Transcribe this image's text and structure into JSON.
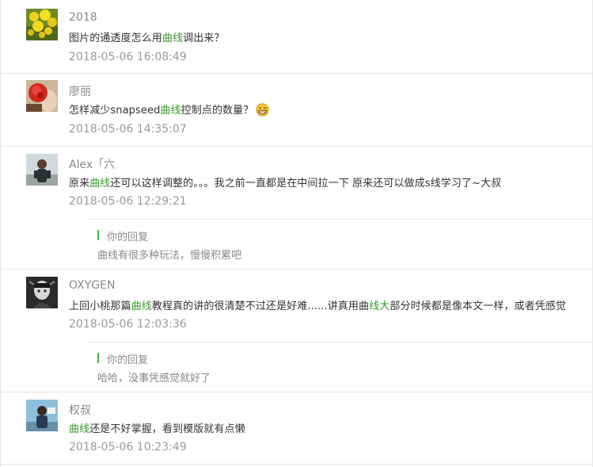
{
  "comments": [
    {
      "nickname": "2018",
      "avatar": "yellow-flower-avatar",
      "content": {
        "before": "图片的通透度怎么用",
        "highlight": "曲线",
        "after": "调出来？"
      },
      "time": "2018-05-06 16:08:49"
    },
    {
      "nickname": "廖丽",
      "avatar": "red-flower-avatar",
      "content": {
        "before": "怎样减少snapseed",
        "highlight": "曲线",
        "after": "控制点的数量？"
      },
      "emoji": "grinning-emoji",
      "time": "2018-05-06 14:35:07"
    },
    {
      "nickname": "Alex「六",
      "avatar": "person-outdoor-avatar",
      "content": {
        "before": "原来",
        "highlight": "曲线",
        "after": "还可以这样调整的。。。我之前一直都是在中间拉一下 原来还可以做成s线学习了~大叔"
      },
      "time": "2018-05-06 12:29:21",
      "reply": {
        "label": "你的回复",
        "text": "曲线有很多种玩法，慢慢积累吧"
      }
    },
    {
      "nickname": "OXYGEN",
      "avatar": "dark-portrait-avatar",
      "content": {
        "before": "上回小桃那篇",
        "highlight": "曲线",
        "middle": "教程真的讲的很清楚不过还是好难......讲真用曲",
        "highlight2": "线大",
        "after": "部分时候都是像本文一样，或者凭感觉"
      },
      "time": "2018-05-06 12:03:36",
      "reply": {
        "label": "你的回复",
        "text": "哈哈，没事凭感觉就好了"
      }
    },
    {
      "nickname": "权叔",
      "avatar": "person-blue-avatar",
      "content": {
        "before": "",
        "highlight": "曲线",
        "after": "还是不好掌握，看到模版就有点懒"
      },
      "time": "2018-05-06 10:23:49"
    }
  ],
  "colors": {
    "highlight": "#3a9a2e",
    "reply_bar": "#3fb838",
    "time": "#9a9a9a",
    "nickname": "#8a8a8a"
  }
}
